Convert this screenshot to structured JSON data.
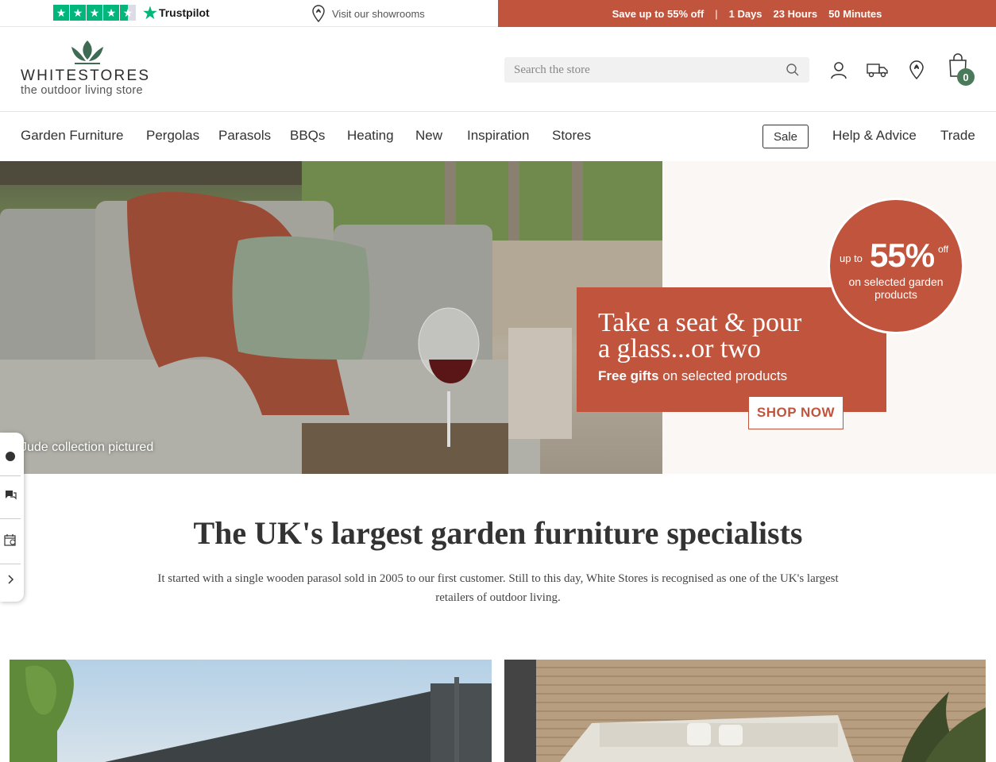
{
  "topbar": {
    "trustpilot_label": "Trustpilot",
    "showrooms_label": "Visit our showrooms",
    "promo": {
      "text": "Save up to 55% off",
      "separator": "|",
      "days": "1 Days",
      "hours": "23 Hours",
      "minutes": "50 Minutes"
    }
  },
  "header": {
    "logo_name": "WHITESTORES",
    "logo_tagline": "the outdoor living store",
    "search_placeholder": "Search the store",
    "cart_count": "0"
  },
  "nav": {
    "items": [
      "Garden Furniture",
      "Pergolas",
      "Parasols",
      "BBQs",
      "Heating",
      "New",
      "Inspiration",
      "Stores"
    ],
    "sale": "Sale",
    "right_items": [
      "Help & Advice",
      "Trade"
    ]
  },
  "hero": {
    "caption": "Jude collection pictured",
    "headline_line1": "Take a seat & pour",
    "headline_line2": "a glass...or two",
    "sub_bold": "Free gifts",
    "sub_rest": " on selected products",
    "cta": "SHOP NOW",
    "badge": {
      "upto": "up to",
      "percent": "55%",
      "off": "off",
      "line1": "on selected garden",
      "line2": "products"
    }
  },
  "intro": {
    "title": "The UK's largest garden furniture specialists",
    "text": "It started with a single wooden parasol sold in 2005 to our first customer. Still to this day, White Stores is recognised as one of the UK's largest retailers of outdoor living."
  },
  "colors": {
    "brand_red": "#c0543d",
    "brand_green": "#3f6b55",
    "trustpilot_green": "#00b67a"
  }
}
